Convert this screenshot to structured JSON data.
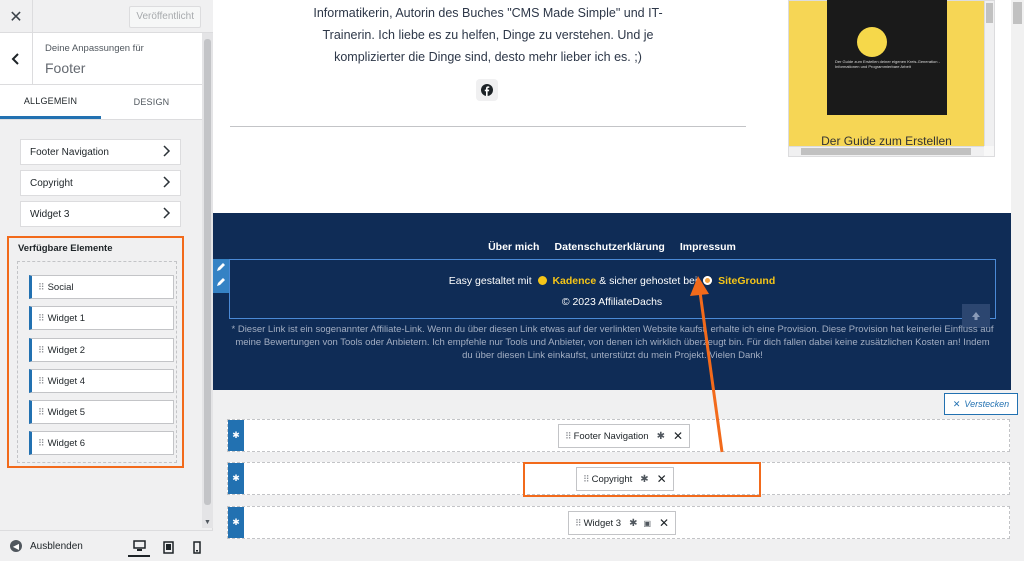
{
  "sidebar": {
    "publish_label": "Veröffentlicht",
    "subtitle": "Deine Anpassungen für",
    "title": "Footer",
    "tabs": [
      {
        "label": "ALLGEMEIN",
        "active": true
      },
      {
        "label": "DESIGN",
        "active": false
      }
    ],
    "nav_rows": [
      {
        "label": "Footer Navigation"
      },
      {
        "label": "Copyright"
      },
      {
        "label": "Widget 3"
      }
    ],
    "available_title": "Verfügbare Elemente",
    "available_items": [
      {
        "label": "Social"
      },
      {
        "label": "Widget 1"
      },
      {
        "label": "Widget 2"
      },
      {
        "label": "Widget 4"
      },
      {
        "label": "Widget 5"
      },
      {
        "label": "Widget 6"
      }
    ],
    "hide_label": "Ausblenden"
  },
  "preview": {
    "bio_lines": [
      "Informatikerin, Autorin des Buches \"CMS Made Simple\" und IT-",
      "Trainerin. Ich liebe es zu helfen, Dinge zu verstehen. Und je",
      "komplizierter die Dinge sind, desto mehr lieber ich es. ;)"
    ],
    "ad_caption": "Der Guide zum Erstellen",
    "ad_book_text": "Der Guide zum Erstellen deiner eigenen Kreis-Generation - Informationen und Programmierbare Arbeit",
    "footer_nav": [
      "Über mich",
      "Datenschutzerklärung",
      "Impressum"
    ],
    "credit": {
      "prefix": "Easy gestaltet mit",
      "brand1": "Kadence",
      "middle": "& sicher gehostet bei",
      "brand2": "SiteGround"
    },
    "copyright": "© 2023 AffiliateDachs",
    "disclaimer": "* Dieser Link ist ein sogenannter Affiliate-Link. Wenn du über diesen Link etwas auf der verlinkten Website kaufst, erhalte ich eine Provision. Diese Provision hat keinerlei Einfluss auf meine Bewertungen von Tools oder Anbietern. Ich empfehle nur Tools und Anbieter, von denen ich wirklich überzeugt bin. Für dich fallen dabei keine zusätzlichen Kosten an! Indem du über diesen Link einkaufst, unterstützt du mein Projekt. Vielen Dank!"
  },
  "builder": {
    "hide_label": "Verstecken",
    "rows": [
      {
        "item": "Footer Navigation"
      },
      {
        "item": "Copyright"
      },
      {
        "item": "Widget 3"
      }
    ]
  },
  "colors": {
    "accent": "#2271b1",
    "highlight": "#f26a1b",
    "footer_bg": "#0f2c56",
    "brand_yellow": "#f5c518"
  },
  "icons": [
    "close-icon",
    "back-icon",
    "chevron-right-icon",
    "grip-icon",
    "gear-icon",
    "x-icon",
    "pencil-icon",
    "facebook-icon",
    "arrow-up-icon",
    "desktop-icon",
    "tablet-icon",
    "mobile-icon",
    "eye-hide-icon"
  ]
}
